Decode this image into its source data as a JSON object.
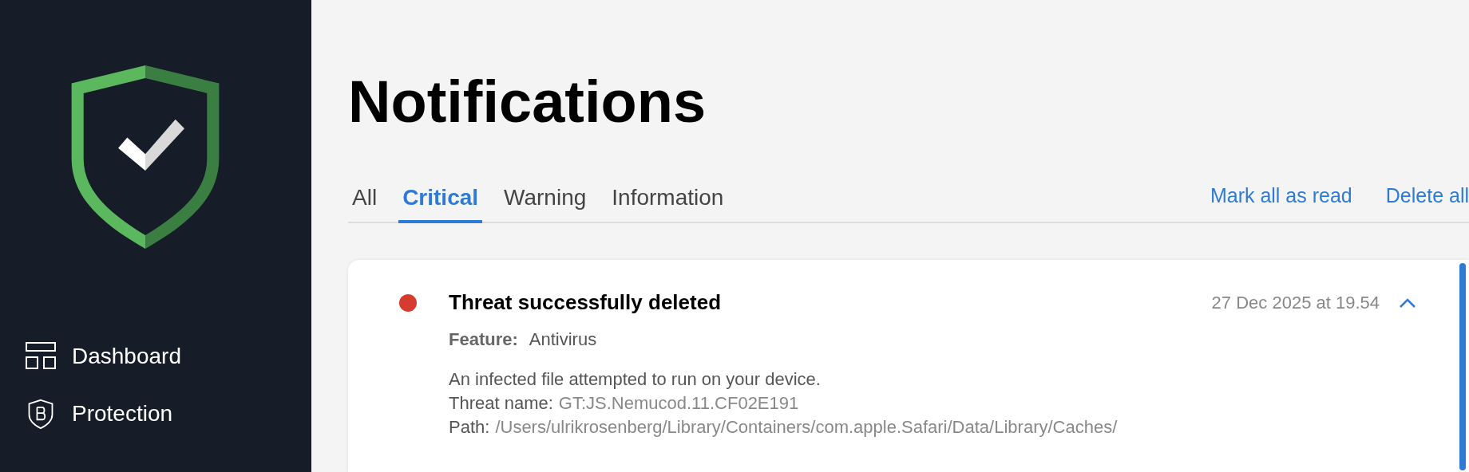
{
  "sidebar": {
    "nav": [
      {
        "kind": "dashboard",
        "label": "Dashboard"
      },
      {
        "kind": "protection",
        "label": "Protection"
      }
    ]
  },
  "page_title": "Notifications",
  "tabs": [
    {
      "label": "All",
      "selected": false
    },
    {
      "label": "Critical",
      "selected": true
    },
    {
      "label": "Warning",
      "selected": false
    },
    {
      "label": "Information",
      "selected": false
    }
  ],
  "actions": [
    "Mark all as read",
    "Delete all"
  ],
  "notifications": [
    {
      "color": "#d63b30",
      "title": "Threat successfully deleted",
      "time": "27 Dec 2025 at 19.54",
      "expanded": true,
      "feature_label": "Feature:",
      "feature": "Antivirus",
      "description": "An infected file attempted to run on your device.",
      "details": [
        {
          "label": "Threat name:",
          "value": "GT:JS.Nemucod.11.CF02E191"
        },
        {
          "label": "Path:",
          "value": "/Users/ulrikrosenberg/Library/Containers/com.apple.Safari/Data/Library/Caches/"
        }
      ]
    }
  ]
}
